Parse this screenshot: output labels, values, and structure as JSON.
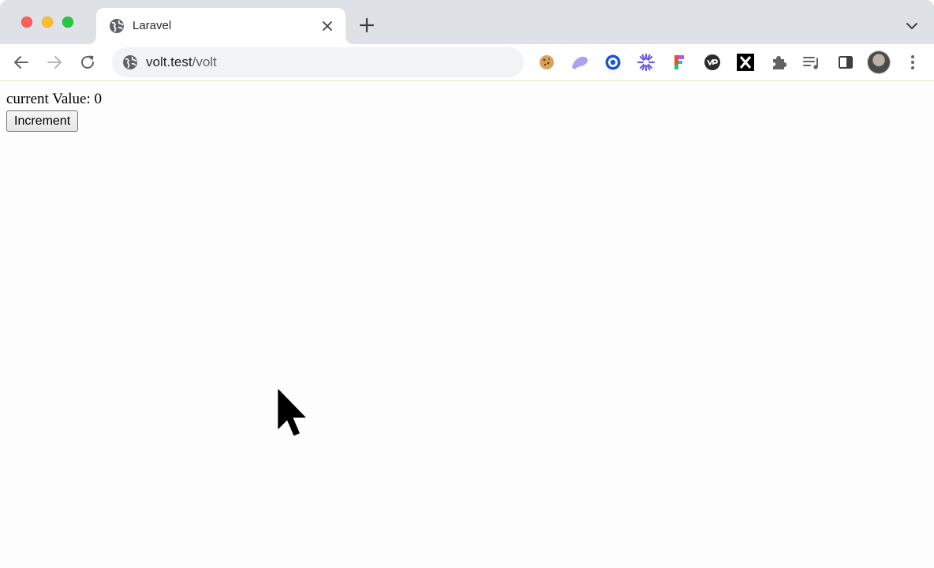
{
  "browser": {
    "tab": {
      "title": "Laravel",
      "favicon_icon": "globe-icon"
    },
    "address_bar": {
      "host": "volt.test",
      "path": "/volt"
    },
    "extensions": [
      "cookie-icon",
      "ghost-icon",
      "target-circle-icon",
      "starburst-icon",
      "figma-f-icon",
      "vp-badge-icon",
      "x-logo-icon",
      "puzzle-icon",
      "reading-list-icon",
      "side-panel-icon"
    ]
  },
  "page": {
    "counter_text": "current Value: 0",
    "increment_label": "Increment"
  },
  "colors": {
    "tabstrip_bg": "#dee1e6",
    "omnibox_bg": "#f1f3f4",
    "close_red": "#fe5f57",
    "minimize_yellow": "#febc2e",
    "zoom_green": "#28c840"
  }
}
